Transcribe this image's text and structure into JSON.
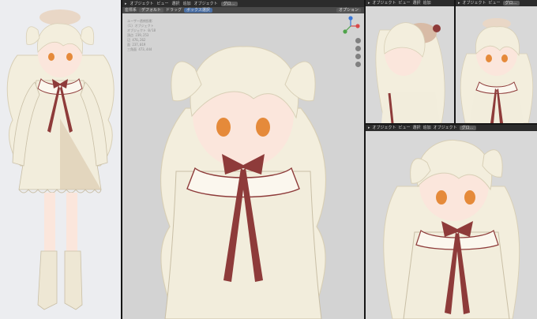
{
  "viewport": {
    "header_items": [
      "オブジェクト",
      "ビュー",
      "選択",
      "追加",
      "オブジェクト",
      "グロ…"
    ],
    "subheader_items": [
      "座標系",
      "デフォルト",
      "ドラッグ",
      "ボックス選択"
    ],
    "options_label": "オプション",
    "stats": [
      "ユーザー透視投影",
      "(1) オブジェクト",
      "オブジェクト 0/18",
      "頂点 239,253",
      "辺 476,262",
      "面 237,019",
      "三角面 473,444"
    ]
  },
  "panel_top_left": {
    "header_items": [
      "オブジェクト",
      "ビュー",
      "選択",
      "追加",
      "オブジェクト",
      "グロ…"
    ]
  },
  "panel_top_right": {
    "header_items": [
      "オブジェクト",
      "ビュー",
      "グロ…"
    ]
  },
  "panel_bottom": {
    "header_items": [
      "オブジェクト",
      "ビュー",
      "選択",
      "追加",
      "オブジェクト",
      "グロ…"
    ]
  },
  "colors": {
    "hair": "#f3eedd",
    "dress": "#f2eddc",
    "ribbon": "#8e3b3a",
    "eye": "#e58a3a",
    "skin": "#fbe6dc",
    "boots": "#eee7d4"
  }
}
